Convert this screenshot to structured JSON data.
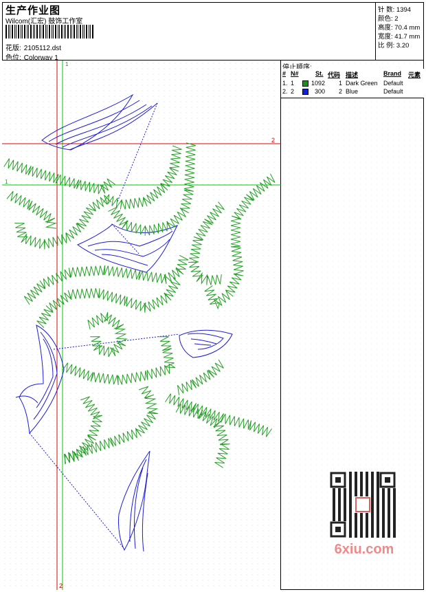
{
  "header": {
    "title": "生产作业图",
    "company": "Wilcom(汇宏) 鼓饰工作室",
    "file_label": "花版:",
    "file_value": "2105112.dst",
    "color_label": "色位:",
    "color_value": "Colorway 1"
  },
  "stats": {
    "stitches_label": "针 数:",
    "stitches_value": "1394",
    "colors_label": "颜色:",
    "colors_value": "2",
    "height_label": "高度:",
    "height_value": "70.4 mm",
    "width_label": "宽度:",
    "width_value": "41.7 mm",
    "scale_label": "比 例:",
    "scale_value": "3.20"
  },
  "stop_sequence": {
    "title": "停止顺序:",
    "columns": [
      "#",
      "N#",
      "St.",
      "代码",
      "描述",
      "Brand",
      "元素"
    ],
    "rows": [
      {
        "num": "1.",
        "n": "1",
        "color": "#1e8f1e",
        "stitches": "1092",
        "code": "1",
        "desc": "Dark Green",
        "brand": "Default"
      },
      {
        "num": "2.",
        "n": "2",
        "color": "#1020e0",
        "stitches": "300",
        "code": "2",
        "desc": "Blue",
        "brand": "Default"
      }
    ]
  },
  "guides": {
    "v_green_label": "1",
    "h_red_label": "2",
    "h_green_label": "1",
    "v_red_label": "2"
  },
  "colors": {
    "green_thread": "#22a022",
    "blue_thread": "#1a1ae0",
    "guide_red": "#dd0000",
    "guide_green": "#00cc00",
    "watermark": "#f08a8a"
  },
  "watermark": {
    "text": "6xiu.com"
  }
}
